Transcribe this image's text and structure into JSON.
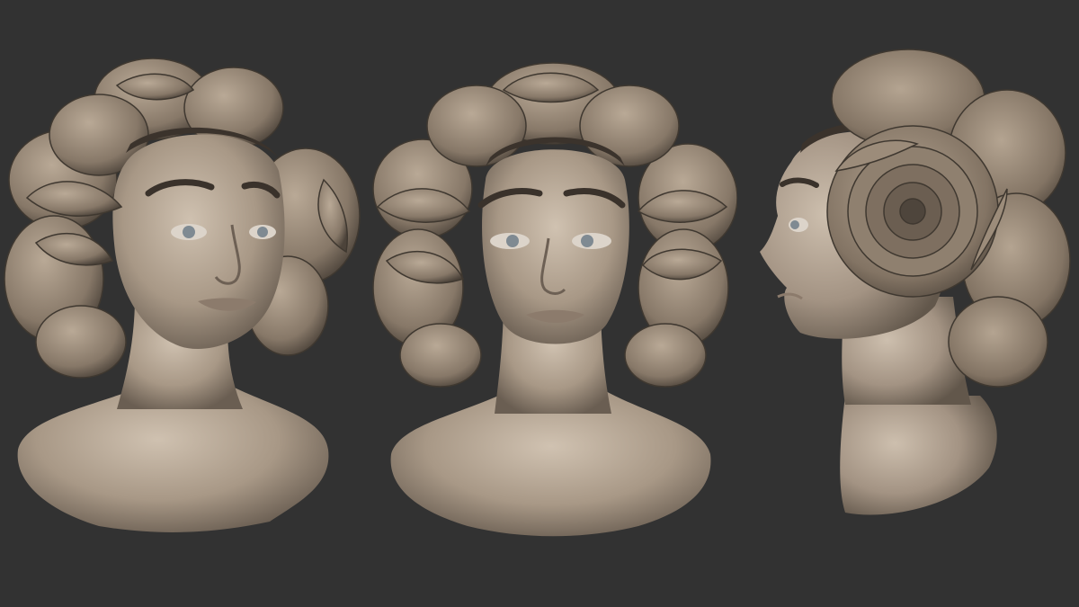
{
  "scene": {
    "background_color": "#323232",
    "material_color": "#a39383",
    "material_shadow": "#5e5348",
    "material_highlight": "#cdbfae",
    "iris_color": "#7f8a92"
  },
  "views": [
    {
      "name": "three-quarter"
    },
    {
      "name": "front"
    },
    {
      "name": "profile"
    }
  ]
}
